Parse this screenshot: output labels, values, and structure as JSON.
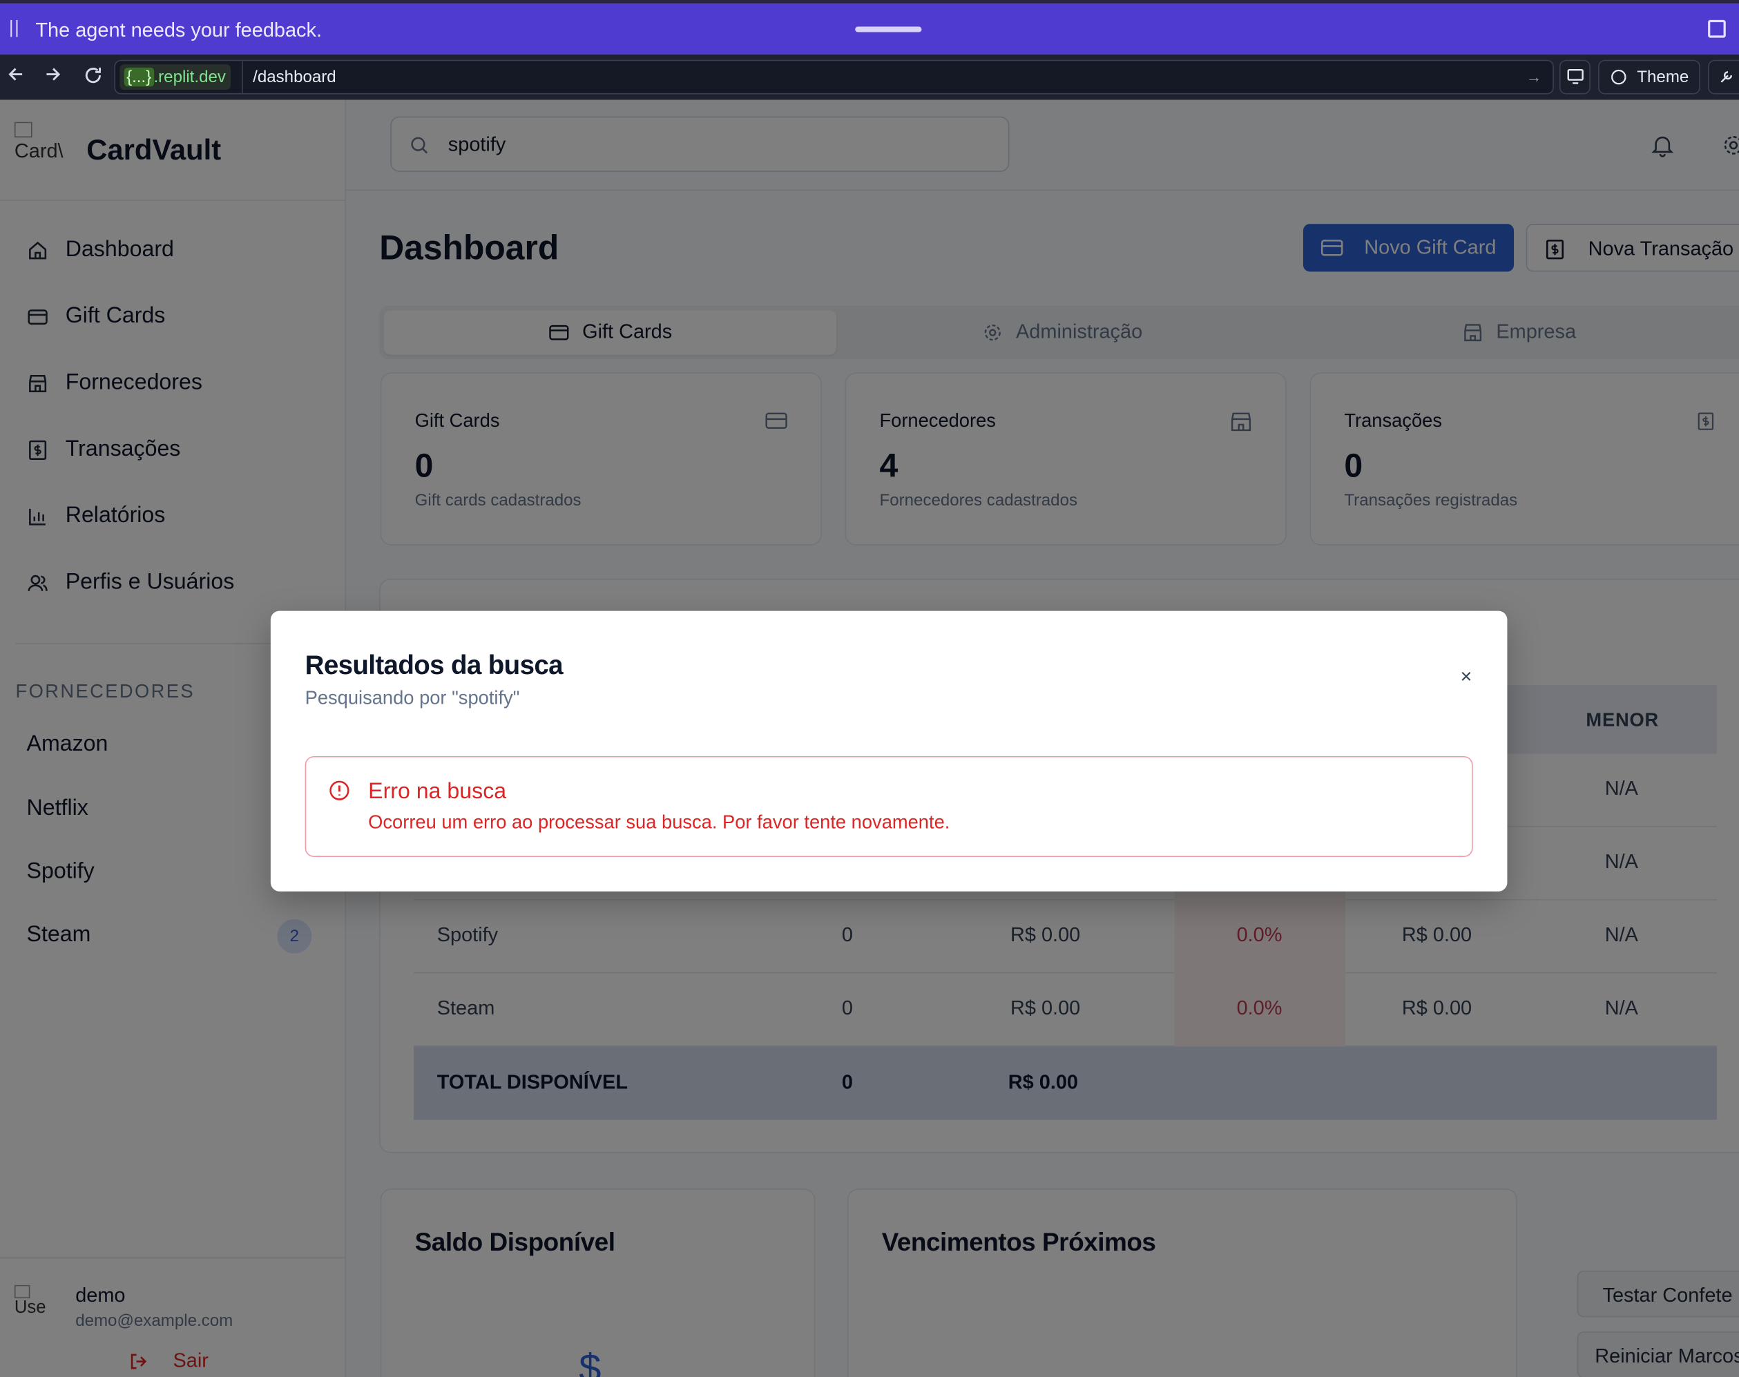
{
  "banner": {
    "message": "The agent needs your feedback."
  },
  "browser": {
    "host_prefix": "{...}",
    "host": ".replit.dev",
    "path": "/dashboard",
    "theme_label": "Theme"
  },
  "sidebar": {
    "brand": "CardVault",
    "logo_alt": "Card\\",
    "nav": [
      {
        "label": "Dashboard",
        "icon": "home-icon"
      },
      {
        "label": "Gift Cards",
        "icon": "credit-card-icon"
      },
      {
        "label": "Fornecedores",
        "icon": "store-icon"
      },
      {
        "label": "Transações",
        "icon": "receipt-dollar-icon"
      },
      {
        "label": "Relatórios",
        "icon": "bar-chart-icon"
      },
      {
        "label": "Perfis e Usuários",
        "icon": "users-icon"
      }
    ],
    "section_title": "FORNECEDORES",
    "suppliers": [
      {
        "label": "Amazon"
      },
      {
        "label": "Netflix"
      },
      {
        "label": "Spotify"
      },
      {
        "label": "Steam",
        "badge": "2"
      }
    ],
    "user": {
      "avatar_alt": "Use",
      "name": "demo",
      "email": "demo@example.com",
      "logout": "Sair"
    }
  },
  "header": {
    "search_value": "spotify"
  },
  "page": {
    "title": "Dashboard",
    "primary_button": "Novo Gift Card",
    "secondary_button": "Nova Transação",
    "tabs": [
      {
        "label": "Gift Cards",
        "icon": "credit-card-icon",
        "active": true
      },
      {
        "label": "Administração",
        "icon": "gear-icon",
        "active": false
      },
      {
        "label": "Empresa",
        "icon": "store-icon",
        "active": false
      }
    ],
    "stats": [
      {
        "title": "Gift Cards",
        "value": "0",
        "subtitle": "Gift cards cadastrados",
        "icon": "credit-card-icon"
      },
      {
        "title": "Fornecedores",
        "value": "4",
        "subtitle": "Fornecedores cadastrados",
        "icon": "store-icon"
      },
      {
        "title": "Transações",
        "value": "0",
        "subtitle": "Transações registradas",
        "icon": "receipt-dollar-icon"
      }
    ],
    "table": {
      "visible_header": "MENOR",
      "rows": [
        {
          "name": "",
          "qty": "",
          "value": "",
          "pct": "",
          "avg": "",
          "min": "N/A"
        },
        {
          "name": "",
          "qty": "",
          "value": "",
          "pct": "",
          "avg": "",
          "min": "N/A"
        },
        {
          "name": "Spotify",
          "qty": "0",
          "value": "R$ 0.00",
          "pct": "0.0%",
          "avg": "R$ 0.00",
          "min": "N/A"
        },
        {
          "name": "Steam",
          "qty": "0",
          "value": "R$ 0.00",
          "pct": "0.0%",
          "avg": "R$ 0.00",
          "min": "N/A"
        }
      ],
      "total": {
        "label": "TOTAL DISPONÍVEL",
        "qty": "0",
        "value": "R$ 0.00"
      }
    },
    "cards": {
      "balance_title": "Saldo Disponível",
      "balance_icon": "dollar-icon",
      "due_title": "Vencimentos Próximos"
    },
    "floating": {
      "confetti": "Testar Confete",
      "reset": "Reiniciar Marcos"
    }
  },
  "modal": {
    "title": "Resultados da busca",
    "subtitle": "Pesquisando por \"spotify\"",
    "close": "×",
    "error_title": "Erro na busca",
    "error_message": "Ocorreu um erro ao processar sua busca. Por favor tente novamente."
  },
  "colors": {
    "accent": "#2f63d6",
    "banner": "#4f3bd0",
    "error": "#dc2626"
  }
}
